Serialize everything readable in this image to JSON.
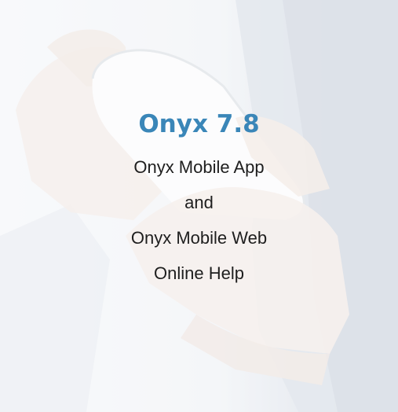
{
  "splash": {
    "title": "Onyx 7.8",
    "lines": [
      "Onyx Mobile App",
      "and",
      "Onyx Mobile Web",
      "Online Help"
    ]
  },
  "colors": {
    "title": "#3a86b8",
    "text": "#1e1e1e",
    "background": "#f4f6f9"
  }
}
